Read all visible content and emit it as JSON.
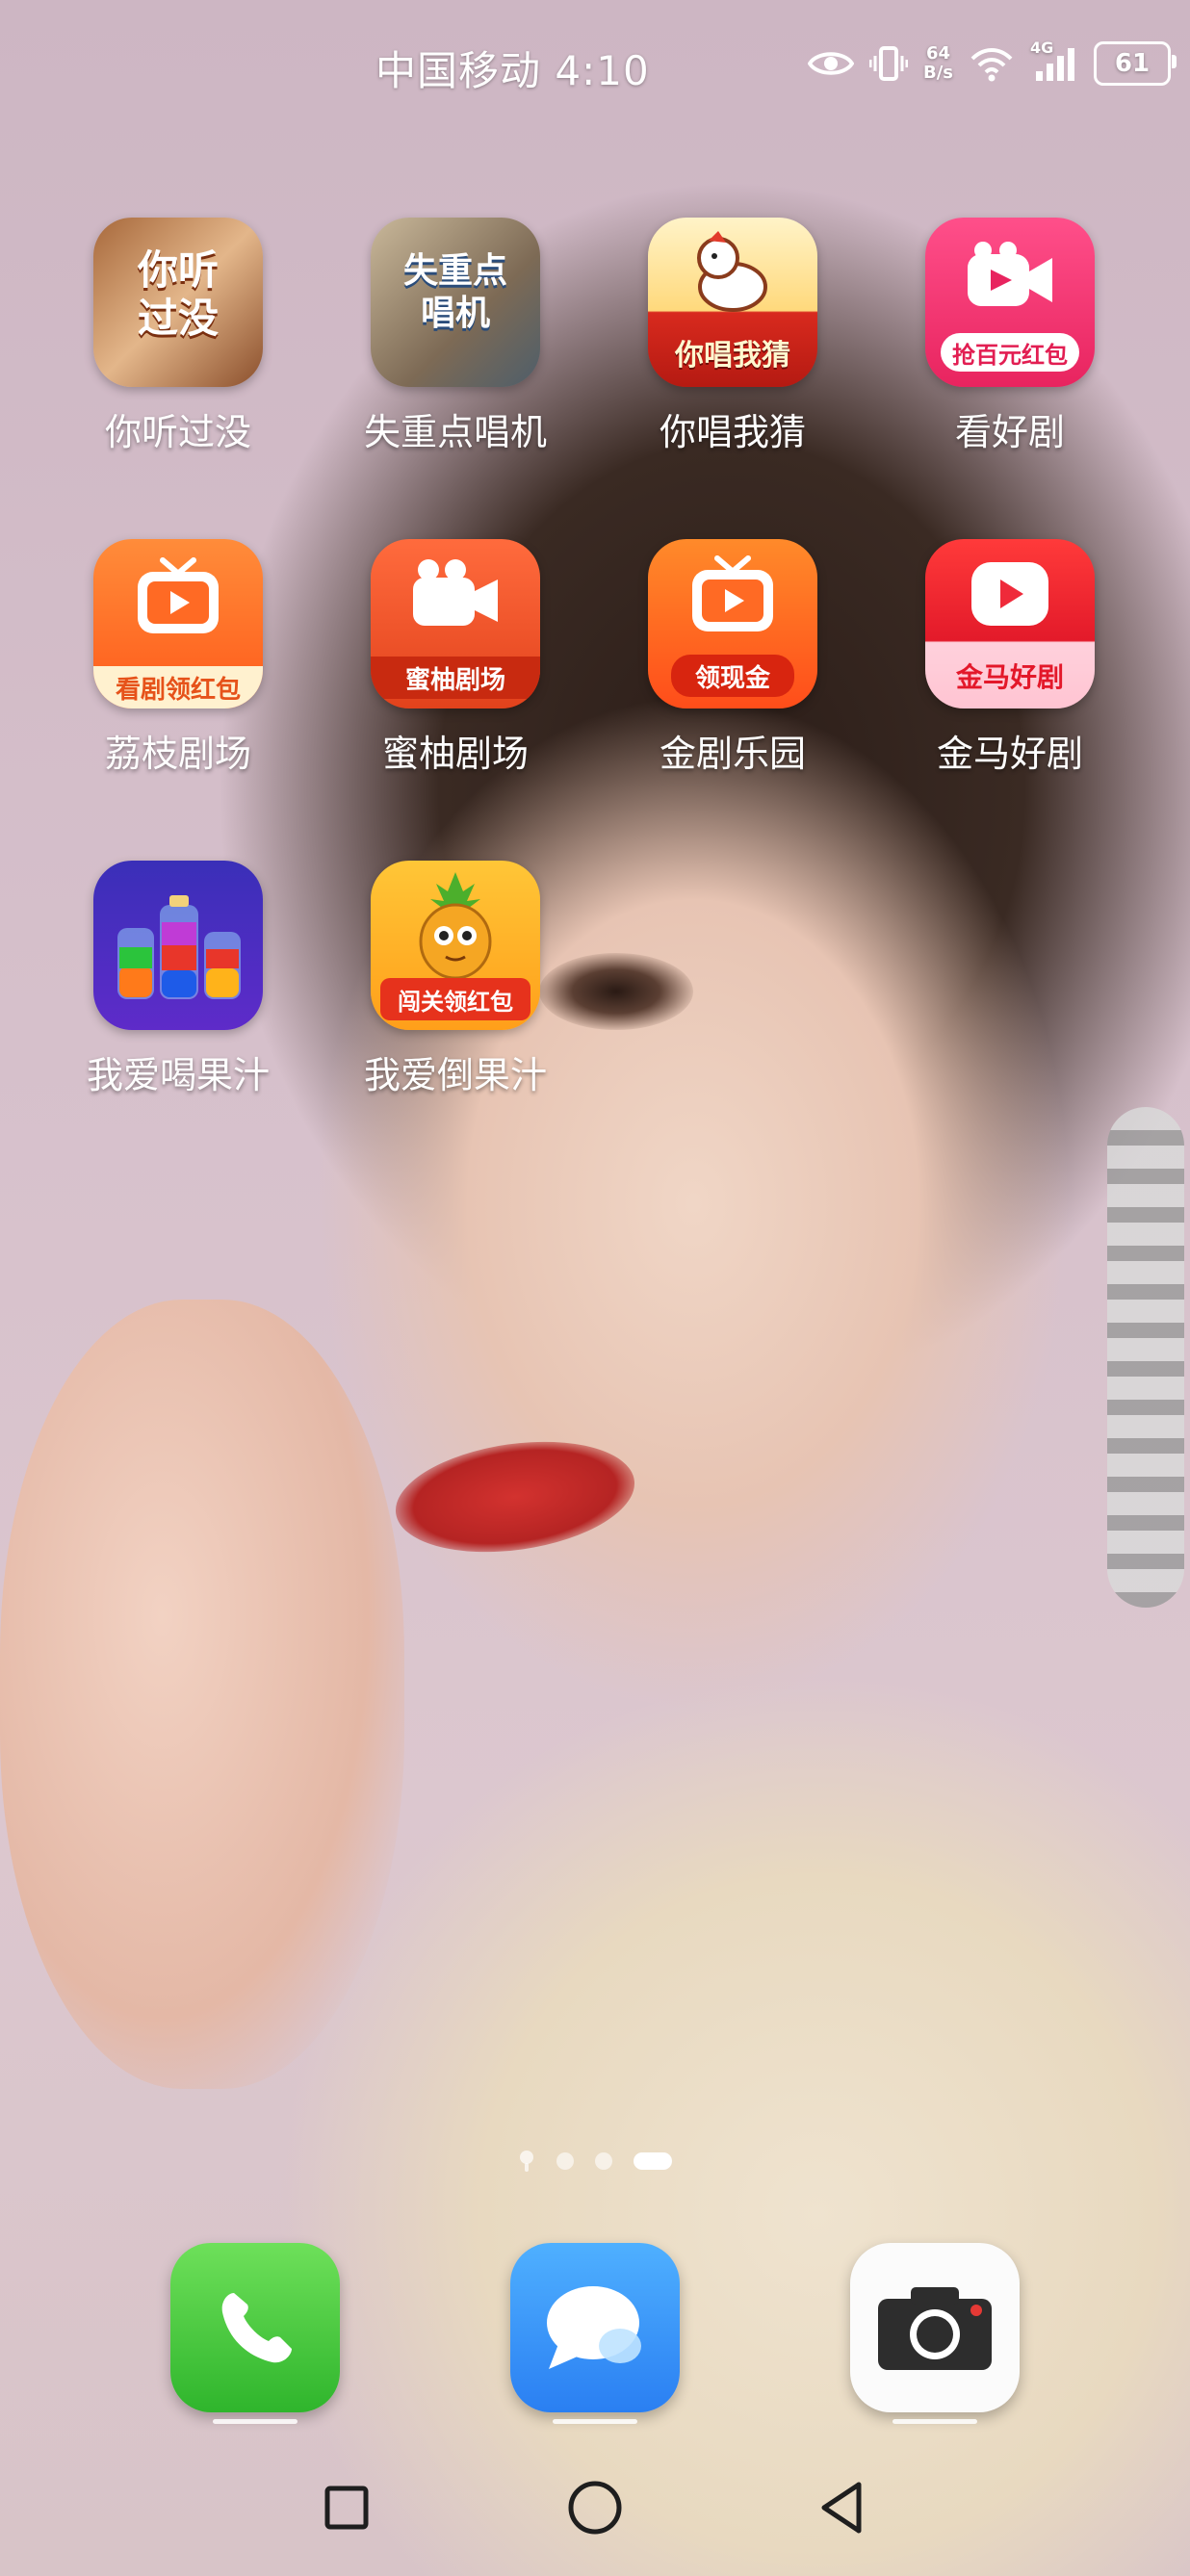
{
  "status_bar": {
    "carrier_time": "中国移动 4:10",
    "net_speed_value": "64",
    "net_speed_unit": "B/s",
    "signal_type": "4G",
    "battery": "61"
  },
  "apps": [
    {
      "label": "你听过没",
      "icon_text": "你听\n过没",
      "icon": "music-quiz-icon"
    },
    {
      "label": "失重点唱机",
      "icon_text": "失重点\n唱机",
      "icon": "jukebox-icon"
    },
    {
      "label": "你唱我猜",
      "icon_text": "你唱我猜",
      "icon": "singing-horse-icon"
    },
    {
      "label": "看好剧",
      "icon_text": "抢百元红包",
      "icon": "video-camera-icon"
    },
    {
      "label": "荔枝剧场",
      "icon_text": "看剧领红包",
      "icon": "tv-play-icon"
    },
    {
      "label": "蜜柚剧场",
      "icon_text": "蜜柚剧场",
      "icon": "video-camera-icon"
    },
    {
      "label": "金剧乐园",
      "icon_text": "领现金",
      "icon": "tv-play-icon"
    },
    {
      "label": "金马好剧",
      "icon_text": "金马好剧",
      "icon": "play-button-icon"
    },
    {
      "label": "我爱喝果汁",
      "icon_text": "",
      "icon": "juice-bottles-icon"
    },
    {
      "label": "我爱倒果汁",
      "icon_text": "闯关领红包",
      "icon": "pineapple-icon"
    }
  ],
  "page_indicator": {
    "pages": 4,
    "current": 4
  },
  "dock": [
    {
      "name": "phone",
      "icon": "phone-icon"
    },
    {
      "name": "messages",
      "icon": "message-bubble-icon"
    },
    {
      "name": "camera",
      "icon": "camera-icon"
    }
  ],
  "nav_bar": [
    "recent-apps-icon",
    "home-icon",
    "back-icon"
  ]
}
